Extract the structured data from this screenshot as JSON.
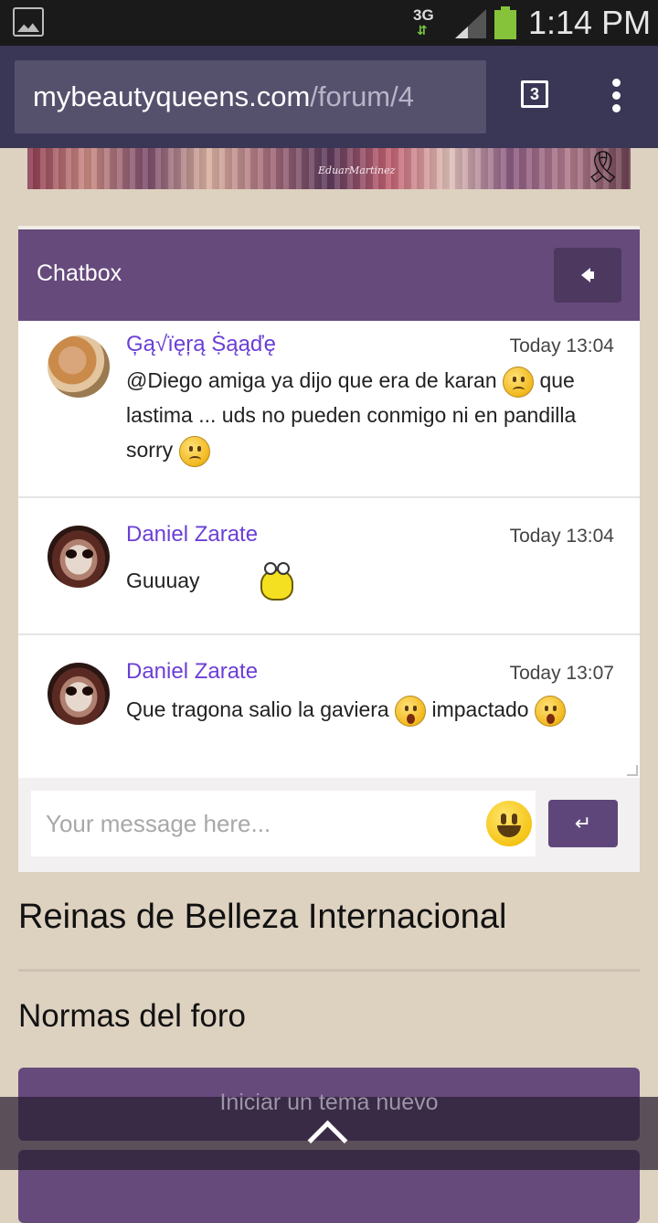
{
  "status_bar": {
    "network": "3G",
    "time": "1:14 PM"
  },
  "browser": {
    "url_domain": "mybeautyqueens.com",
    "url_path": "/forum/4",
    "tab_count": "3"
  },
  "chatbox": {
    "title": "Chatbox",
    "messages": [
      {
        "author": "Ģą√ïęŗą Ṩąąďę",
        "time": "Today 13:04",
        "text_parts": [
          "@Diego amiga ya dijo que era de karan",
          "que lastima ... uds no pueden conmigo ni en pandilla sorry"
        ],
        "emojis": [
          "sad-emoji",
          "sad-emoji"
        ]
      },
      {
        "author": "Daniel Zarate",
        "time": "Today 13:04",
        "text_parts": [
          "Guuuay"
        ],
        "emojis": [
          "animated-bird-emoji"
        ]
      },
      {
        "author": "Daniel Zarate",
        "time": "Today 13:07",
        "text_parts": [
          "Que tragona salio la gaviera",
          "impactado"
        ],
        "emojis": [
          "surprised-emoji",
          "surprised-emoji"
        ]
      }
    ],
    "input_placeholder": "Your message here...",
    "send_symbol": "↵"
  },
  "sections": {
    "forum_title": "Reinas de Belleza Internacional",
    "rules": "Normas del foro",
    "new_topic_button": "Iniciar un tema nuevo"
  },
  "banner_signature": "EduarMartinez",
  "colors": {
    "primary_purple": "#664a7b",
    "author_link": "#6a3fd6",
    "page_bg": "#ddd1c0"
  }
}
